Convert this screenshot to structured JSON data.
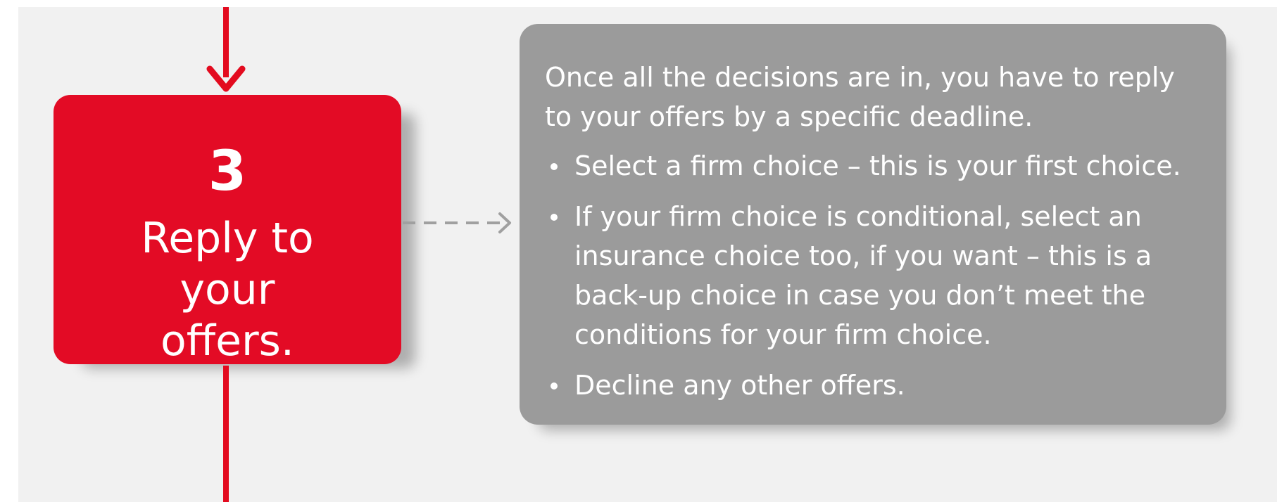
{
  "step": {
    "number": "3",
    "title": "Reply to your offers."
  },
  "info": {
    "intro": "Once all the decisions are in, you have to reply to your offers by a specific deadline.",
    "bullets": [
      "Select a firm choice – this is your first choice.",
      "If your firm choice is conditional, select an insurance choice too, if you want – this is a back-up choice in case you don’t meet the conditions for your firm choice.",
      "Decline any other offers."
    ]
  },
  "colors": {
    "accent_red": "#e30b25",
    "info_grey": "#9b9b9b",
    "background": "#f1f1f1"
  },
  "icons": {
    "flow_arrow": "arrow-down-icon",
    "connector": "dashed-arrow-right-icon"
  }
}
